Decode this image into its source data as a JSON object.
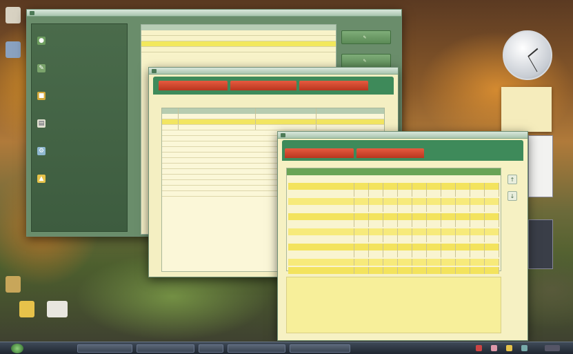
{
  "main_window": {
    "title": ""
  },
  "sidebar": {
    "items": [
      {
        "label": "",
        "icon": "group-icon",
        "color": "#6e9e60"
      },
      {
        "label": "",
        "icon": "pen-icon",
        "color": "#7aa36b"
      },
      {
        "label": "",
        "icon": "folder-icon",
        "color": "#d4a83a"
      },
      {
        "label": "",
        "icon": "document-icon",
        "color": "#e0e0d0"
      },
      {
        "label": "",
        "icon": "tools-icon",
        "color": "#8fb8d0"
      },
      {
        "label": "",
        "icon": "person-icon",
        "color": "#e7c24a"
      }
    ]
  },
  "main_list": {
    "rows": [
      "",
      "",
      "",
      ""
    ]
  },
  "side_buttons": [
    {
      "label": "",
      "icon": "pen-icon"
    },
    {
      "label": "",
      "icon": "pen-icon"
    }
  ],
  "middle_window": {
    "title": "",
    "tabs": [
      "",
      "",
      ""
    ],
    "columns": [
      "",
      "",
      "",
      ""
    ],
    "rows": [
      [
        "",
        "",
        "",
        ""
      ],
      [
        "",
        "",
        "",
        ""
      ],
      [
        "",
        "",
        "",
        ""
      ]
    ]
  },
  "front_window": {
    "title": "",
    "tabs": [
      "",
      ""
    ],
    "header": "",
    "rows": [
      {
        "label": "",
        "nums": ""
      },
      {
        "label": "",
        "nums": ""
      },
      {
        "label": "",
        "nums": ""
      },
      {
        "label": "",
        "nums": ""
      },
      {
        "label": "",
        "nums": ""
      },
      {
        "label": "",
        "nums": ""
      },
      {
        "label": "",
        "nums": ""
      }
    ]
  },
  "taskbar": {
    "buttons": [
      "",
      "",
      "",
      "",
      ""
    ]
  },
  "colors": {
    "accent_green": "#3e8a5a",
    "tab_red": "#d9482c",
    "highlight_yellow": "#f2e85c"
  }
}
